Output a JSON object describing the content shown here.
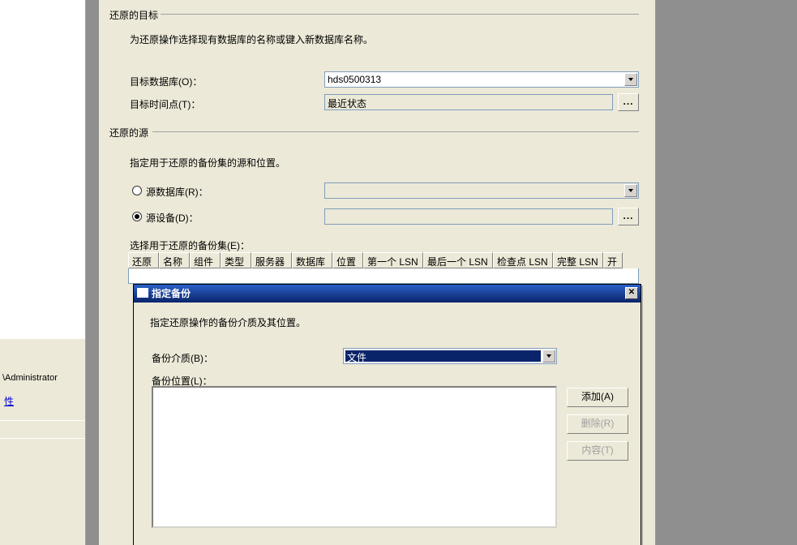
{
  "left": {
    "admin": "\\Administrator",
    "link": "性"
  },
  "restore": {
    "target_title": "还原的目标",
    "target_hint": "为还原操作选择现有数据库的名称或键入新数据库名称。",
    "dest_db_label": "目标数据库(O)：",
    "dest_db_value": "hds0500313",
    "dest_time_label": "目标时间点(T)：",
    "dest_time_value": "最近状态",
    "source_title": "还原的源",
    "source_hint": "指定用于还原的备份集的源和位置。",
    "radio_db": "源数据库(R)：",
    "radio_dev": "源设备(D)：",
    "sets_label": "选择用于还原的备份集(E)：",
    "browse": "..."
  },
  "table": {
    "cols": [
      "还原",
      "名称",
      "组件",
      "类型",
      "服务器",
      "数据库",
      "位置",
      "第一个 LSN",
      "最后一个 LSN",
      "检查点 LSN",
      "完整 LSN",
      "开"
    ]
  },
  "modal": {
    "title": "指定备份",
    "hint": "指定还原操作的备份介质及其位置。",
    "media_label": "备份介质(B)：",
    "media_value": "文件",
    "loc_label": "备份位置(L)：",
    "add": "添加(A)",
    "remove": "删除(R)",
    "contents": "内容(T)"
  }
}
